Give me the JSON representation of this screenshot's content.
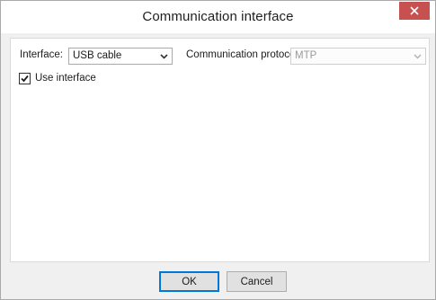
{
  "window": {
    "title": "Communication interface"
  },
  "form": {
    "interface_label": "Interface:",
    "interface_value": "USB cable",
    "protocol_label": "Communication protocol:",
    "protocol_value": "MTP",
    "use_interface_label": "Use interface",
    "use_interface_checked": true
  },
  "buttons": {
    "ok_label": "OK",
    "cancel_label": "Cancel"
  },
  "icons": {
    "close": "close-icon",
    "dropdown": "chevron-down-icon",
    "check": "checkmark-icon"
  },
  "colors": {
    "close_button": "#c75050",
    "default_button_border": "#0078d7"
  }
}
